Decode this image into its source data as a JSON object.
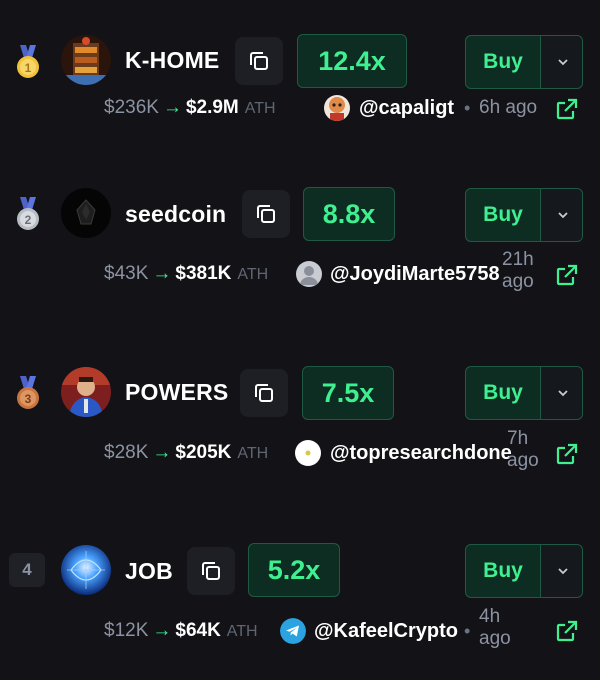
{
  "tokens": [
    {
      "rank_medal": "gold-medal",
      "avatar": "k-home-avatar",
      "name": "K-HOME",
      "multiplier": "12.4x",
      "buy_label": "Buy",
      "from_mc": "$236K",
      "arrow": "→",
      "to_mc": "$2.9M",
      "ath_label": "ATH",
      "caller_icon": "cartoon-avatar",
      "caller_handle": "@capaligt",
      "dot": "•",
      "time_line1": "6h ago",
      "time_line2": ""
    },
    {
      "rank_medal": "silver-medal",
      "avatar": "seedcoin-avatar",
      "name": "seedcoin",
      "multiplier": "8.8x",
      "buy_label": "Buy",
      "from_mc": "$43K",
      "arrow": "→",
      "to_mc": "$381K",
      "ath_label": "ATH",
      "caller_icon": "default-user-avatar",
      "caller_handle": "@JoydiMarte5758",
      "dot": "",
      "time_line1": "21h",
      "time_line2": "ago"
    },
    {
      "rank_medal": "bronze-medal",
      "avatar": "powers-avatar",
      "name": "POWERS",
      "multiplier": "7.5x",
      "buy_label": "Buy",
      "from_mc": "$28K",
      "arrow": "→",
      "to_mc": "$205K",
      "ath_label": "ATH",
      "caller_icon": "white-circle-avatar",
      "caller_handle": "@topresearchdone",
      "dot": "",
      "time_line1": "7h",
      "time_line2": "ago"
    },
    {
      "rank_number": "4",
      "avatar": "job-avatar",
      "name": "JOB",
      "multiplier": "5.2x",
      "buy_label": "Buy",
      "from_mc": "$12K",
      "arrow": "→",
      "to_mc": "$64K",
      "ath_label": "ATH",
      "caller_icon": "telegram-icon",
      "caller_handle": "@KafeelCrypto",
      "dot": "•",
      "time_line1": "4h",
      "time_line2": "ago"
    }
  ],
  "colors": {
    "accent_green": "#3ef090",
    "background": "#131317",
    "muted_text": "#8b93a3"
  }
}
